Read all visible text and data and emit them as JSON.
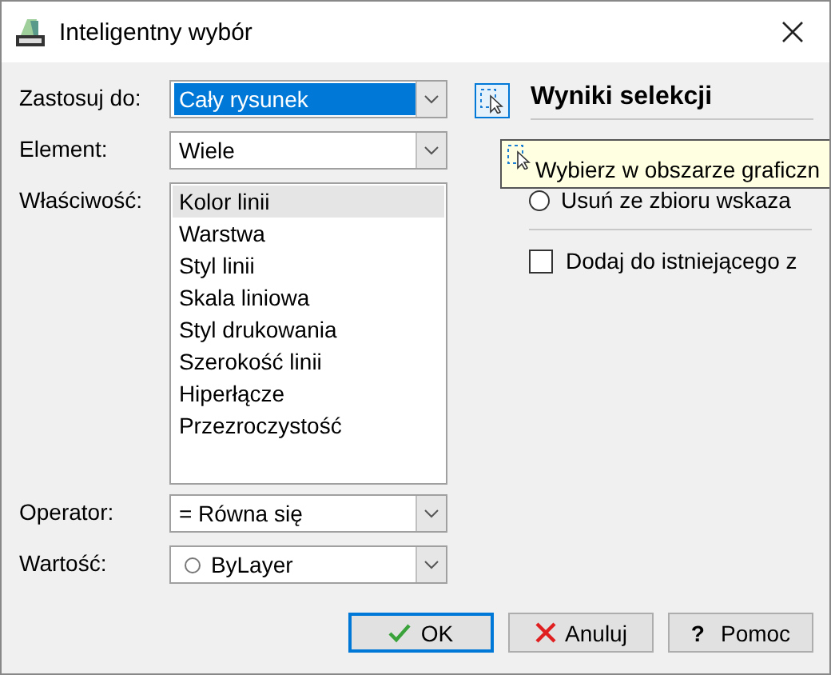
{
  "window": {
    "title": "Inteligentny wybór"
  },
  "form": {
    "apply_to": {
      "label": "Zastosuj do:",
      "value": "Cały rysunek",
      "highlighted": true
    },
    "element": {
      "label": "Element:",
      "value": "Wiele",
      "highlighted": false
    },
    "property": {
      "label": "Właściwość:",
      "items": [
        {
          "label": "Kolor linii",
          "selected": true
        },
        {
          "label": "Warstwa",
          "selected": false
        },
        {
          "label": "Styl linii",
          "selected": false
        },
        {
          "label": "Skala liniowa",
          "selected": false
        },
        {
          "label": "Styl drukowania",
          "selected": false
        },
        {
          "label": "Szerokość linii",
          "selected": false
        },
        {
          "label": "Hiperłącze",
          "selected": false
        },
        {
          "label": "Przezroczystość",
          "selected": false
        }
      ]
    },
    "operator": {
      "label": "Operator:",
      "value": "= Równa się",
      "highlighted": false
    },
    "value": {
      "label": "Wartość:",
      "value": "ByLayer",
      "highlighted": false
    }
  },
  "results": {
    "title": "Wyniki selekcji",
    "options": [
      {
        "kind": "radio",
        "label": "Usuń ze zbioru wskaza",
        "selected": false
      }
    ],
    "append": {
      "label": "Dodaj do istniejącego z",
      "checked": false
    }
  },
  "tooltip": {
    "text": "Wybierz w obszarze graficzn"
  },
  "buttons": [
    {
      "label": "OK",
      "kind": "confirm",
      "default": true
    },
    {
      "label": "Anuluj",
      "kind": "cancel",
      "default": false
    },
    {
      "label": "Pomoc",
      "kind": "help",
      "glyph": "?",
      "default": false
    }
  ]
}
